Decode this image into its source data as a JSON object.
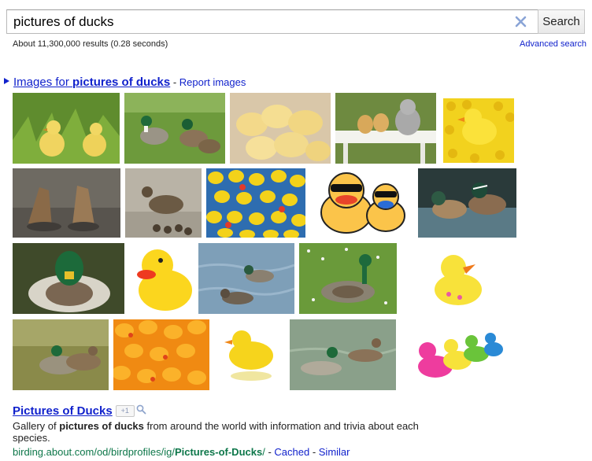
{
  "search": {
    "query": "pictures of ducks",
    "button_label": "Search",
    "clear_symbol": "×"
  },
  "stats": "About 11,300,000 results (0.28 seconds)",
  "advanced_search": "Advanced search",
  "images_block": {
    "title_prefix": "Images for ",
    "title_query": "pictures of ducks",
    "separator": " - ",
    "report_label": "Report images",
    "thumbnails": [
      "ducklings-in-grass",
      "mallards-on-grass",
      "yellow-ducklings-group",
      "kitten-with-ducklings-on-bench",
      "rubber-ducks-field",
      "ducks-diving-tails-up",
      "female-mallard-with-ducklings",
      "rubber-ducks-floating",
      "cartoon-ducks-with-sunglasses",
      "wood-ducks-on-water",
      "mallard-drake-closeup",
      "yellow-rubber-duck-large",
      "ducks-on-blue-water",
      "mallard-walking-on-grass",
      "yellow-rubber-duck-white-background",
      "mallard-pair-grass",
      "orange-rubber-ducks-pile",
      "rubber-duck-reflection",
      "mallard-pair-swimming",
      "colorful-rubber-ducks-row"
    ]
  },
  "result": {
    "title": "Pictures of Ducks",
    "plus_one": "+1",
    "snippet_1": "Gallery of ",
    "snippet_bold": "pictures of ducks",
    "snippet_2": " from around the world with information and trivia about each species.",
    "url_plain": "birding.about.com/od/birdprofiles/ig/",
    "url_bold": "Pictures-of-Ducks",
    "url_tail": "/",
    "sep1": " - ",
    "cached": "Cached",
    "sep2": " - ",
    "similar": "Similar"
  },
  "colors": {
    "link": "#1122cc",
    "url_green": "#0e774a",
    "duck_yellow": "#f6d21c",
    "grass_green": "#5c8a2c",
    "water_blue": "#6f8fa8"
  }
}
